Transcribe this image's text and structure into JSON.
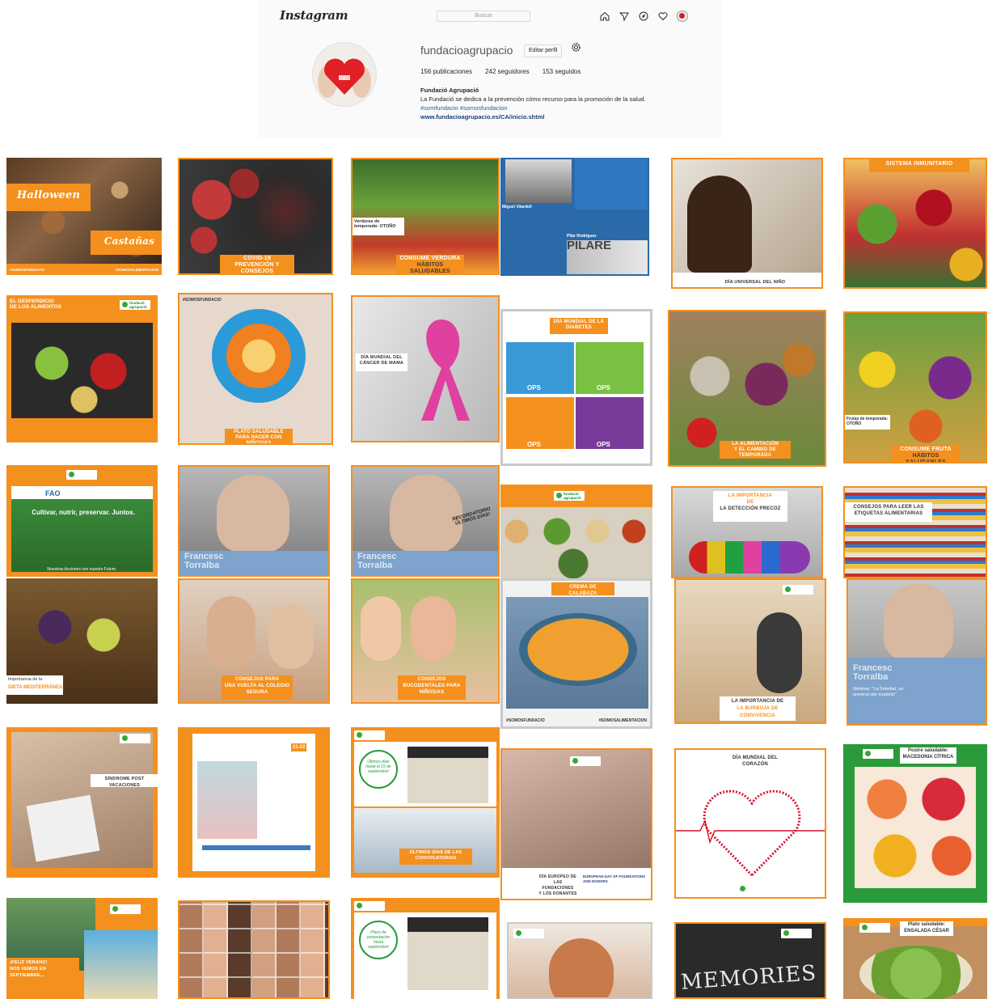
{
  "topbar": {
    "logo": "Instagram",
    "search_placeholder": "Buscar",
    "icons": [
      "home-icon",
      "explore-icon",
      "compass-icon",
      "heart-icon",
      "profile-avatar-icon"
    ]
  },
  "profile": {
    "username": "fundacioagrupacio",
    "edit_label": "Editar perfil",
    "stats": {
      "posts": "156 publicaciones",
      "followers": "242 seguidores",
      "following": "153 seguidos"
    },
    "bio_name": "Fundació Agrupació",
    "bio_desc": "La Fundació se dedica a la prevención cómo recurso para la promoción de la salud.",
    "bio_tags": "#somfundacio #somosfundacion",
    "bio_link": "www.fundacioagrupacio.es/CA/inicio.shtml"
  },
  "colors": {
    "orange": "#f4901e",
    "link": "#1c3e7a",
    "tag": "#2f5aa6"
  },
  "posts": {
    "p1": {
      "title1": "Halloween",
      "title2": "Castañas",
      "tag1": "#SOMOSFUNDACIO",
      "tag2": "#SOMOSALIMENTACION"
    },
    "p2": {
      "line1": "COVID-19",
      "line2": "PREVENCIÓN Y CONSEJOS"
    },
    "p3": {
      "label": "Verduras de temporada: OTOÑO",
      "line1": "CONSUME VERDURA",
      "line2": "HÁBITOS SALUDABLES"
    },
    "p4": {
      "name1": "Miguel Vilardell",
      "name2": "Pilar Rodríguez",
      "word": "PILARE"
    },
    "p5": {
      "caption": "DÍA UNIVERSAL DEL NIÑO"
    },
    "p6": {
      "caption": "SISTEMA INMUNITARIO"
    },
    "p7": {
      "title": "EL DESPERDICIO DE LOS ALIMENTOS",
      "brand": "fundació agrupació"
    },
    "p8": {
      "line1": "PLATO SALUDABLE",
      "line2": "PARA HACER CON NIÑOS/AS",
      "tag": "#SOMOSFUNDACIO"
    },
    "p9": {
      "line1": "DÍA MUNDIAL DEL",
      "line2": "CÁNCER DE MAMA"
    },
    "p10": {
      "title": "DÍA MUNDIAL DE LA DIABETES",
      "ops": "OPS"
    },
    "p11": {
      "line1": "LA ALIMENTACIÓN",
      "line2": "Y EL CAMBIO DE TEMPORADA"
    },
    "p12": {
      "label": "Frutas de temporada: OTOÑO",
      "line1": "CONSUME FRUTA",
      "line2": "HÁBITOS SALUDABLES"
    },
    "p13": {
      "fao": "FAO",
      "banner": "Cultivar, nutrir, preservar. Juntos.",
      "footer": "Nuestras Acciones son nuestro Futuro."
    },
    "p14": {
      "name": "Francesc Torralba"
    },
    "p15": {
      "name": "Francesc Torralba",
      "stamp": "RECORDATORIO ÚLTIMOS DÍAS!"
    },
    "p16": {
      "brand": "fundació agrupació"
    },
    "p17": {
      "line1": "LA IMPORTANCIA",
      "line2": "DE",
      "line3": "LA DETECCIÓN PRECOZ"
    },
    "p18": {
      "line1": "CONSEJOS PARA LEER LAS",
      "line2": "ETIQUETAS ALIMENTARIAS"
    },
    "p19": {
      "line1": "Importancia de la",
      "line2": "DIETA MEDITERRÁNEA"
    },
    "p20": {
      "line1": "CONSEJOS PARA",
      "line2": "UNA VUELTA AL COLEGIO",
      "line3": "SEGURA"
    },
    "p21": {
      "line1": "CONSEJOS",
      "line2": "BUCODENTALES PARA",
      "line3": "NIÑOS/AS"
    },
    "p22": {
      "caption": "CREMA DE CALABAZA",
      "tag1": "#SOMOSFUNDACIO",
      "tag2": "#SOMOSALIMENTACION"
    },
    "p23": {
      "line1": "LA IMPORTANCIA DE",
      "line2": "LA BURBUJA DE CONVIVENCIA"
    },
    "p24": {
      "name": "Francesc Torralba",
      "webinar": "Webinar: \"La Soledad, un universo por explorar\""
    },
    "p25": {
      "caption": "SÍNDROME POST VACACIONES"
    },
    "p26": {
      "dates": "21-22"
    },
    "p27": {
      "bubble": "Últimos días hasta el 15 de septiembre!",
      "line1": "ÚLTIMOS DÍAS DE LAS",
      "line2": "CONVOCATORIAS"
    },
    "p28": {
      "line1": "DÍA EUROPEO DE",
      "line2": "LAS FUNDACIONES",
      "line3": "Y LOS DONANTES",
      "logo": "EUROPEAN DAY OF FOUNDATIONS AND DONORS"
    },
    "p29": {
      "line1": "DÍA MUNDIAL DEL",
      "line2": "CORAZÓN"
    },
    "p30": {
      "line1": "Postre saludable:",
      "line2": "MACEDONIA CÍTRICA"
    },
    "p31": {
      "line1": "¡FELIZ VERANO!",
      "line2": "NOS VEMOS EN SEPTIEMBRE..."
    },
    "p32": {},
    "p33": {
      "bubble": "Plazo de presentación hasta septiembre!"
    },
    "p34": {},
    "p35": {
      "word": "MEMORIES"
    },
    "p36": {
      "line1": "Plato saludable:",
      "line2": "ENSALADA CÉSAR"
    }
  }
}
